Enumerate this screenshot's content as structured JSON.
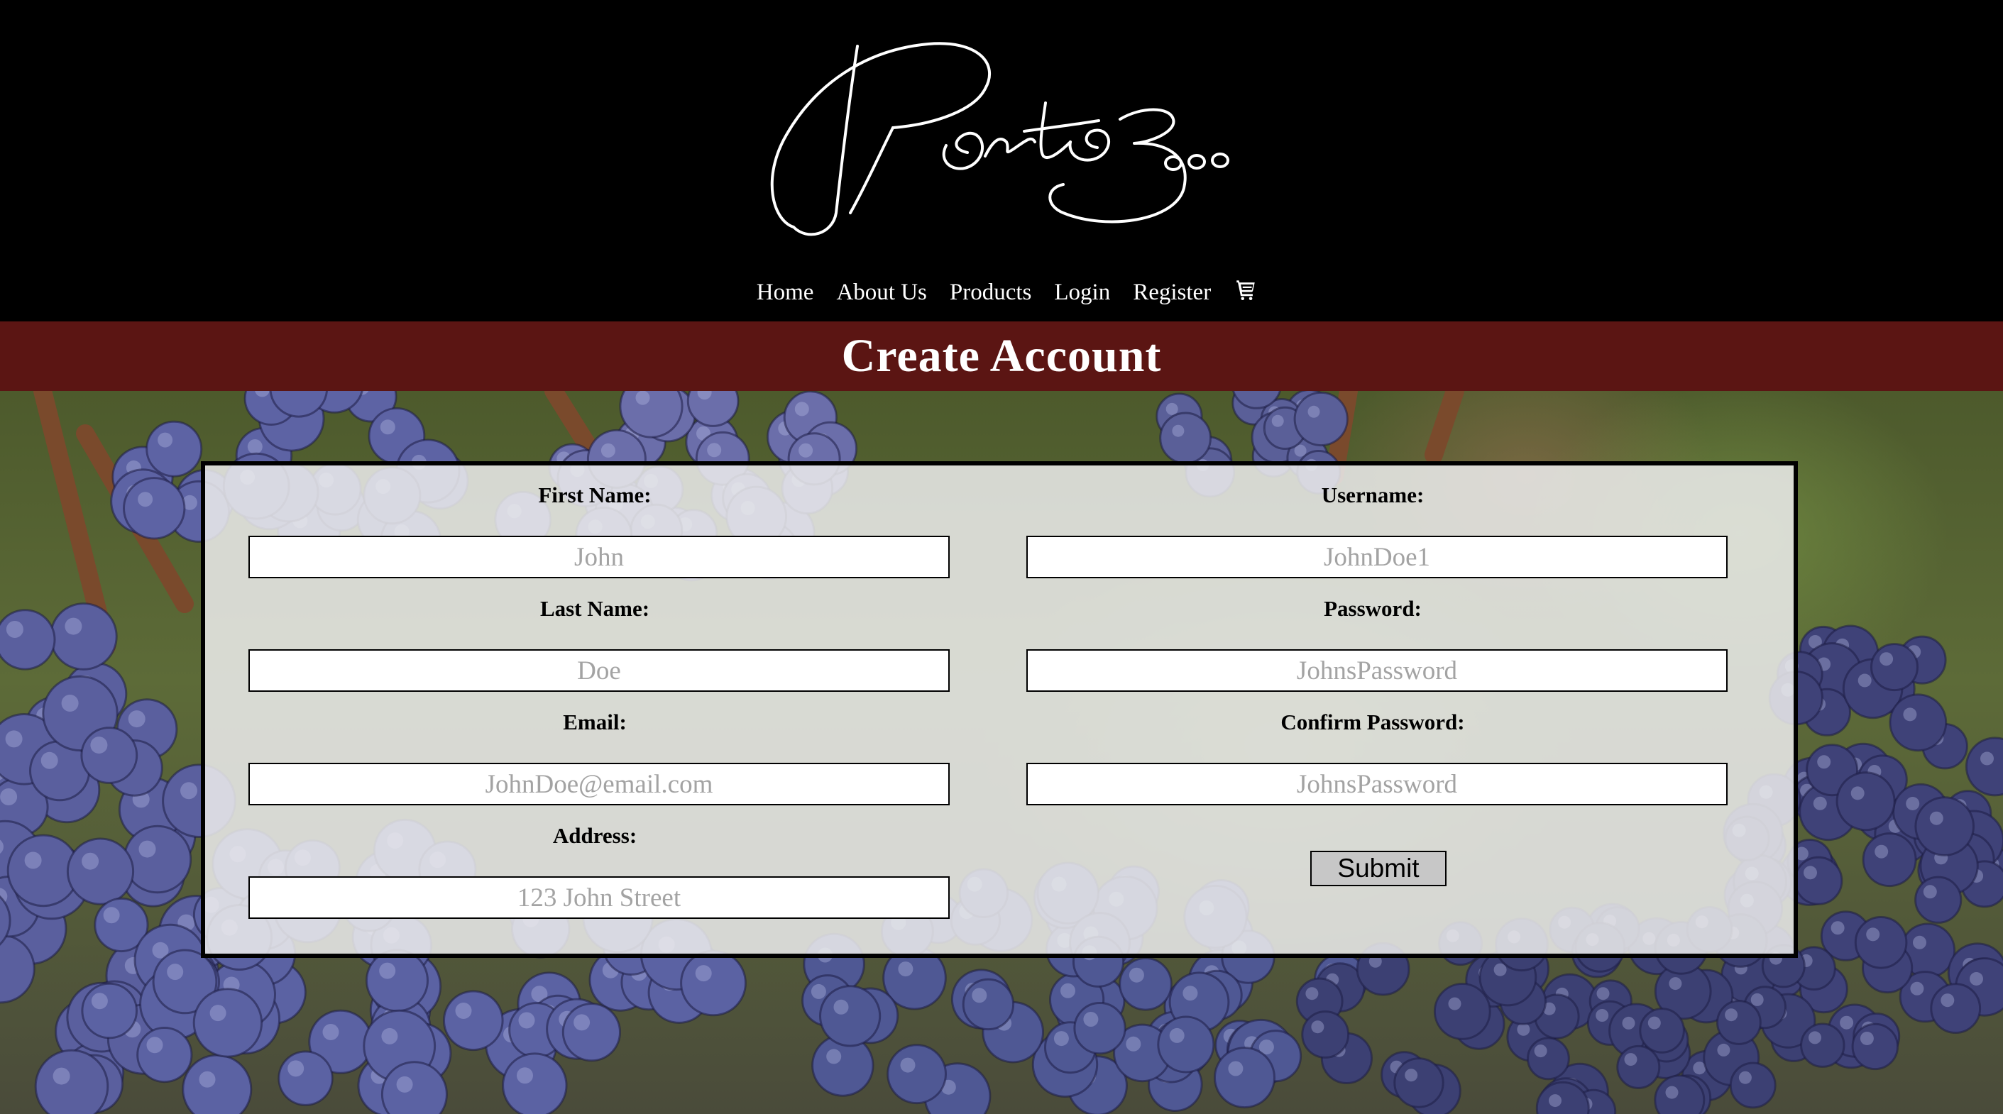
{
  "brand": {
    "logo_text": "Porto3000"
  },
  "nav": {
    "items": [
      "Home",
      "About Us",
      "Products",
      "Login",
      "Register"
    ],
    "cart_icon": "cart-icon"
  },
  "page": {
    "title": "Create Account"
  },
  "form": {
    "first_name": {
      "label": "First Name:",
      "placeholder": "John",
      "value": ""
    },
    "last_name": {
      "label": "Last Name:",
      "placeholder": "Doe",
      "value": ""
    },
    "email": {
      "label": "Email:",
      "placeholder": "JohnDoe@email.com",
      "value": ""
    },
    "address": {
      "label": "Address:",
      "placeholder": "123 John Street",
      "value": ""
    },
    "username": {
      "label": "Username:",
      "placeholder": "JohnDoe1",
      "value": ""
    },
    "password": {
      "label": "Password:",
      "placeholder": "JohnsPassword",
      "value": ""
    },
    "confirm_password": {
      "label": "Confirm Password:",
      "placeholder": "JohnsPassword",
      "value": ""
    },
    "submit_label": "Submit"
  },
  "colors": {
    "header_bg": "#000000",
    "title_bar_bg": "#5b1513",
    "panel_bg": "#ececec",
    "submit_bg": "#c7c7c7"
  }
}
